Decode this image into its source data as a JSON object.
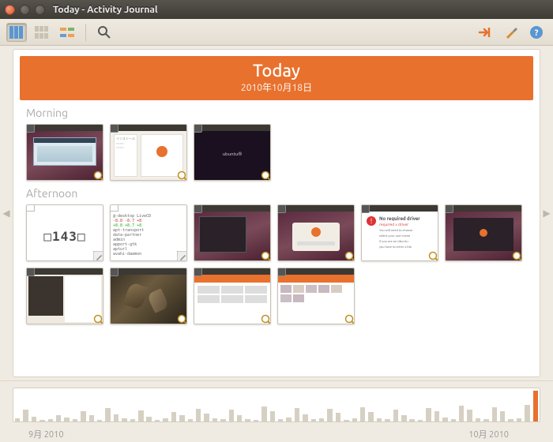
{
  "window": {
    "title": "Today - Activity Journal"
  },
  "toolbar": {
    "view_columns_active": true
  },
  "day": {
    "title": "Today",
    "date": "2010年10月18日"
  },
  "sections": {
    "morning_label": "Morning",
    "afternoon_label": "Afternoon"
  },
  "morning_items": [
    {
      "kind": "screenshot",
      "style": "purple-world"
    },
    {
      "kind": "screenshot",
      "style": "installer"
    },
    {
      "kind": "screenshot",
      "style": "dark-ubuntu"
    }
  ],
  "afternoon_items": [
    {
      "kind": "text",
      "style": "143"
    },
    {
      "kind": "text",
      "style": "code"
    },
    {
      "kind": "screenshot",
      "style": "dark-panel"
    },
    {
      "kind": "screenshot",
      "style": "login-ubuntu"
    },
    {
      "kind": "screenshot",
      "style": "error-dialog",
      "error_title": "No required driver"
    },
    {
      "kind": "screenshot",
      "style": "dark-panel-2"
    },
    {
      "kind": "screenshot",
      "style": "menu-open"
    },
    {
      "kind": "screenshot",
      "style": "leaves"
    },
    {
      "kind": "screenshot",
      "style": "journal-grid"
    },
    {
      "kind": "screenshot",
      "style": "journal-thumbs"
    }
  ],
  "timeline": {
    "labels": [
      "9月 2010",
      "10月 2010"
    ],
    "bars": [
      10,
      35,
      15,
      5,
      8,
      20,
      12,
      6,
      30,
      18,
      5,
      40,
      22,
      10,
      8,
      33,
      15,
      5,
      9,
      28,
      20,
      6,
      38,
      25,
      10,
      8,
      36,
      18,
      7,
      5,
      45,
      30,
      8,
      12,
      40,
      22,
      6,
      10,
      38,
      26,
      5,
      9,
      42,
      28,
      10,
      6,
      35,
      20,
      8,
      5,
      40,
      30,
      12,
      6,
      48,
      36,
      10,
      8,
      44,
      30,
      6,
      10,
      50,
      92
    ],
    "highlight_last": true
  }
}
